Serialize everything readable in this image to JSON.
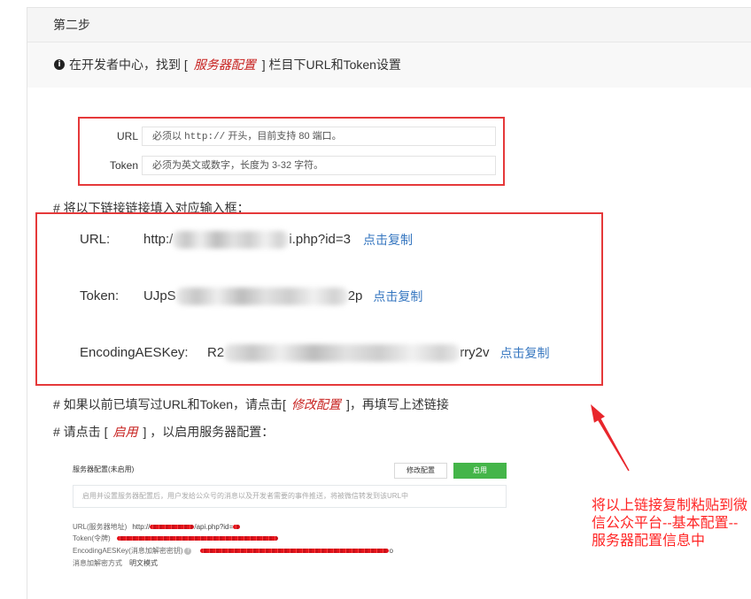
{
  "step_header": {
    "title": "第二步"
  },
  "info": {
    "icon": "info-circle-icon",
    "text_before": "在开发者中心，找到 [",
    "highlight": "服务器配置",
    "text_after": "] 栏目下URL和Token设置"
  },
  "form_preview": {
    "url_label": "URL",
    "url_placeholder_a": "必须以 ",
    "url_placeholder_code": "http://",
    "url_placeholder_b": " 开头，目前支持 80 端口。",
    "token_label": "Token",
    "token_placeholder": "必须为英文或数字，长度为 3-32 字符。"
  },
  "instruction_fill": "# 将以下链接链接填入对应输入框：",
  "links": {
    "copy_label": "点击复制",
    "rows": [
      {
        "label": "URL:",
        "prefix": "http:/",
        "suffix": "i.php?id=3"
      },
      {
        "label": "Token:",
        "prefix": "UJpS",
        "suffix": "2p"
      },
      {
        "label": "EncodingAESKey:",
        "prefix": "R2",
        "suffix": "rry2v"
      }
    ]
  },
  "instruction_modify": {
    "before": "# 如果以前已填写过URL和Token，请点击[",
    "highlight": "修改配置",
    "after": "]，再填写上述链接"
  },
  "instruction_enable": {
    "before": "# 请点击 [",
    "highlight": "启用",
    "after": "] ，以启用服务器配置："
  },
  "server_config_preview": {
    "title": "服务器配置(未启用)",
    "modify_button": "修改配置",
    "enable_button": "启用",
    "notice": "启用并设置服务器配置后，用户发给公众号的消息以及开发者需要的事件推送，将被微信转发到该URL中",
    "url_label": "URL(服务器地址)",
    "url_prefix": "http://",
    "url_suffix": "/api.php?id=",
    "token_label": "Token(令牌)",
    "aes_label": "EncodingAESKey(消息加解密密钥)",
    "aes_help_icon": "help-circle-icon",
    "aes_suffix": "o",
    "mode_label": "消息加解密方式",
    "mode_value": "明文模式"
  },
  "annotation": {
    "lines": [
      "将以上链接复制粘贴到微",
      "信公众平台--基本配置--",
      "服务器配置信息中"
    ],
    "arrow_icon": "red-arrow-icon"
  },
  "colors": {
    "highlight_red": "#c7211f",
    "link_blue": "#3777c0",
    "annotation_red": "#ff2424",
    "enable_green": "#44b549",
    "frame_red": "#e5393a"
  }
}
